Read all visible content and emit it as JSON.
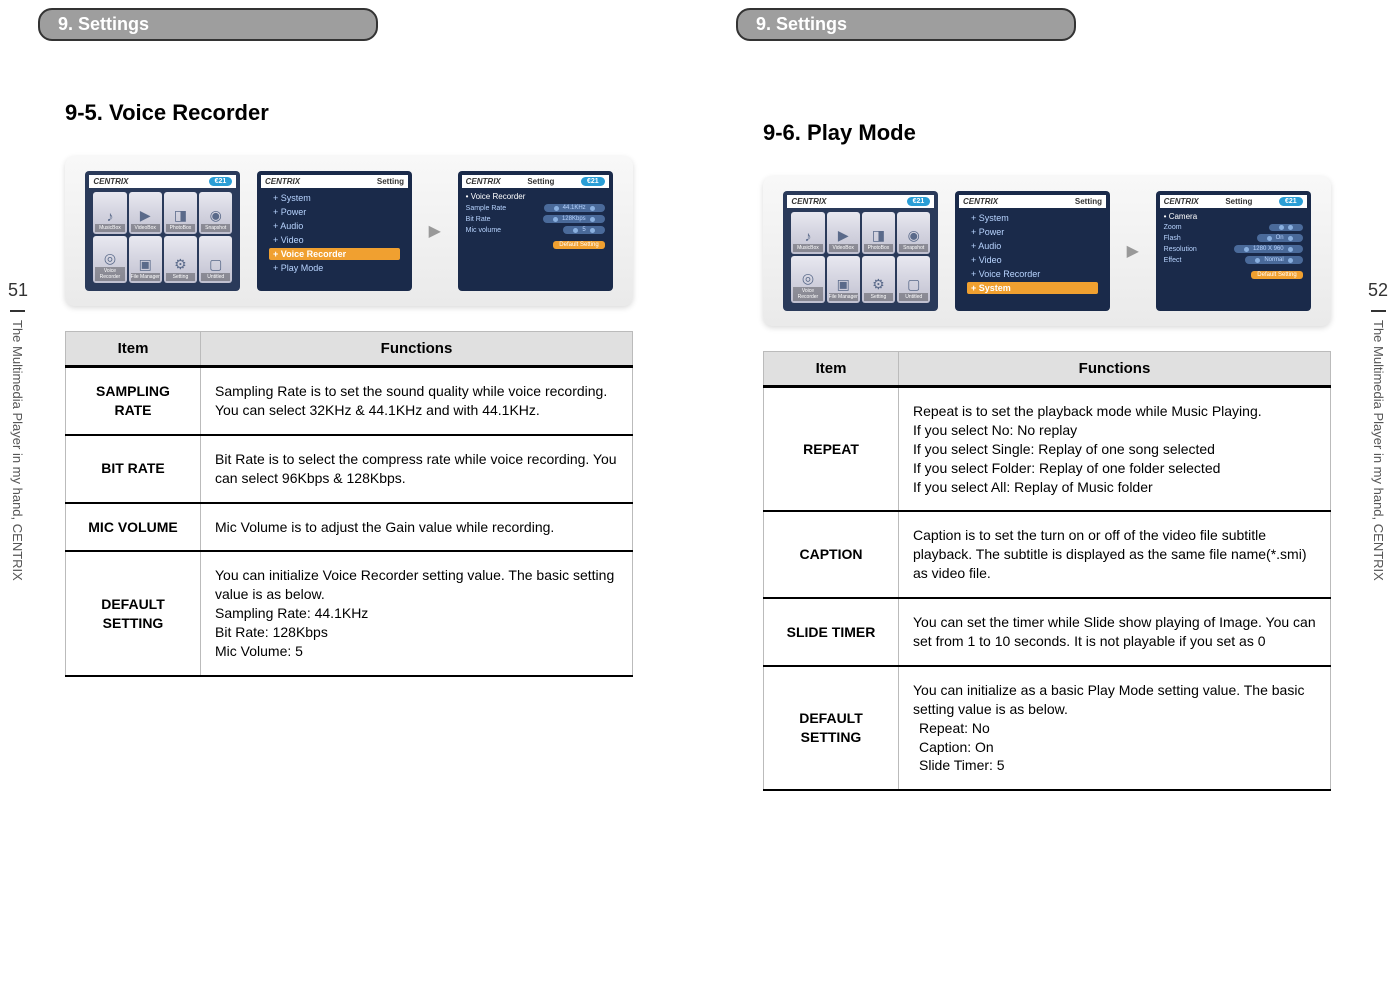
{
  "side_text": "The Multimedia Player in my hand, CENTRIX",
  "left": {
    "page_num": "51",
    "tab": "9. Settings",
    "heading": "9-5. Voice Recorder",
    "devices": {
      "logo": "CENTRIX",
      "pill": "€21",
      "header2": "Setting",
      "header3": "Setting",
      "icons": [
        "MusicBox",
        "VideoBox",
        "PhotoBox",
        "Snapshot",
        "Voice Recorder",
        "File Manager",
        "Setting",
        "Untitled"
      ],
      "menu": [
        "System",
        "Power",
        "Audio",
        "Video",
        "Voice Recorder",
        "Play Mode"
      ],
      "menu_active": "Voice Recorder",
      "settings_title": "Voice Recorder",
      "settings": [
        {
          "k": "Sample Rate",
          "v": "44.1KHz"
        },
        {
          "k": "Bit Rate",
          "v": "128Kbps"
        },
        {
          "k": "Mic volume",
          "v": "5"
        }
      ],
      "default_btn": "Default Setting"
    },
    "table": {
      "head_item": "Item",
      "head_func": "Functions",
      "rows": [
        {
          "item": "SAMPLING RATE",
          "func": [
            "Sampling Rate is to set the sound quality while voice recording. You can select 32KHz & 44.1KHz and with 44.1KHz."
          ]
        },
        {
          "item": "BIT RATE",
          "func": [
            "Bit Rate is to select the compress rate while voice recording. You can select 96Kbps & 128Kbps."
          ]
        },
        {
          "item": "MIC VOLUME",
          "func": [
            "Mic Volume is to adjust the Gain value while recording."
          ]
        },
        {
          "item": "DEFAULT SETTING",
          "func": [
            "You can initialize Voice Recorder setting value. The basic setting value is as below.",
            "Sampling Rate: 44.1KHz",
            "Bit Rate: 128Kbps",
            "Mic Volume: 5"
          ]
        }
      ]
    }
  },
  "right": {
    "page_num": "52",
    "tab": "9. Settings",
    "heading": "9-6. Play Mode",
    "devices": {
      "logo": "CENTRIX",
      "pill": "€21",
      "header2": "Setting",
      "header3": "Setting",
      "icons": [
        "MusicBox",
        "VideoBox",
        "PhotoBox",
        "Snapshot",
        "Voice Recorder",
        "File Manager",
        "Setting",
        "Untitled"
      ],
      "menu": [
        "System",
        "Power",
        "Audio",
        "Video",
        "Voice Recorder",
        "System"
      ],
      "menu_active": "System",
      "settings_title": "Camera",
      "settings": [
        {
          "k": "Zoom",
          "v": ""
        },
        {
          "k": "Flash",
          "v": "On"
        },
        {
          "k": "Resolution",
          "v": "1280 X 960"
        },
        {
          "k": "Effect",
          "v": "Normal"
        }
      ],
      "default_btn": "Default Setting"
    },
    "table": {
      "head_item": "Item",
      "head_func": "Functions",
      "rows": [
        {
          "item": "REPEAT",
          "func": [
            "Repeat is to set the playback mode while Music Playing.",
            "If you select No: No replay",
            "If you select Single: Replay of one song selected",
            "If you select Folder: Replay of one folder selected",
            "If you select All: Replay of Music folder"
          ]
        },
        {
          "item": "CAPTION",
          "func": [
            "Caption is to set the turn on or off of the video file subtitle playback. The subtitle is displayed as the same file name(*.smi) as video file."
          ]
        },
        {
          "item": "SLIDE TIMER",
          "func": [
            "You can set the timer while Slide show playing of Image. You can set from 1 to 10 seconds. It is not playable if you set as 0"
          ]
        },
        {
          "item": "DEFAULT SETTING",
          "func": [
            "You can initialize as a basic Play Mode setting value. The basic setting value is as below.",
            " Repeat: No",
            " Caption: On",
            " Slide Timer: 5"
          ]
        }
      ]
    }
  }
}
